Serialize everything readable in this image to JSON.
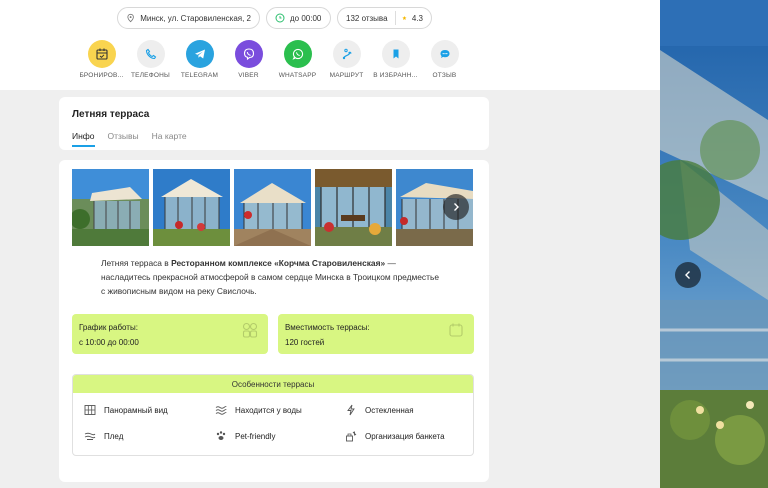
{
  "header": {
    "address": "Минск, ул. Старовиленская, 2",
    "hours": "до 00:00",
    "reviews_count": "132 отзыва",
    "rating": "4.3"
  },
  "actions": [
    {
      "label": "БРОНИРОВ...",
      "icon": "calendar-icon",
      "color": "#f9d44f"
    },
    {
      "label": "ТЕЛЕФОНЫ",
      "icon": "phone-icon",
      "color": "#eeeeee"
    },
    {
      "label": "TELEGRAM",
      "icon": "telegram-icon",
      "color": "#2aa3df"
    },
    {
      "label": "VIBER",
      "icon": "viber-icon",
      "color": "#7a4ddd"
    },
    {
      "label": "WHATSAPP",
      "icon": "whatsapp-icon",
      "color": "#2bbf4e"
    },
    {
      "label": "МАРШРУТ",
      "icon": "route-icon",
      "color": "#eeeeee"
    },
    {
      "label": "В ИЗБРАНН...",
      "icon": "bookmark-icon",
      "color": "#eeeeee"
    },
    {
      "label": "ОТЗЫВ",
      "icon": "chat-icon",
      "color": "#eeeeee"
    }
  ],
  "venue": {
    "title": "Летняя терраса",
    "tabs": [
      "Инфо",
      "Отзывы",
      "На карте"
    ],
    "active_tab": "Инфо"
  },
  "description": {
    "pre": "Летняя терраса в ",
    "bold": "Ресторанном комплексе «Корчма Старовиленская»",
    "post": " — насладитесь прекрасной атмосферой в самом сердце Минска в Троицком предместье с живописным видом на реку Свислочь."
  },
  "info_boxes": [
    {
      "title": "График работы:",
      "value": "с 10:00 до 00:00",
      "icon": "schedule-icon"
    },
    {
      "title": "Вместимость террасы:",
      "value": "120 гостей",
      "icon": "capacity-icon"
    }
  ],
  "features": {
    "title": "Особенности террасы",
    "items": [
      {
        "label": "Панорамный вид",
        "icon": "panorama-icon"
      },
      {
        "label": "Находится у воды",
        "icon": "water-icon"
      },
      {
        "label": "Остекленная",
        "icon": "glass-icon"
      },
      {
        "label": "Плед",
        "icon": "blanket-icon"
      },
      {
        "label": "Pet-friendly",
        "icon": "paw-icon"
      },
      {
        "label": "Организация банкета",
        "icon": "banquet-icon"
      }
    ]
  },
  "colors": {
    "accent": "#1aa0e6",
    "highlight": "#d8f682"
  }
}
